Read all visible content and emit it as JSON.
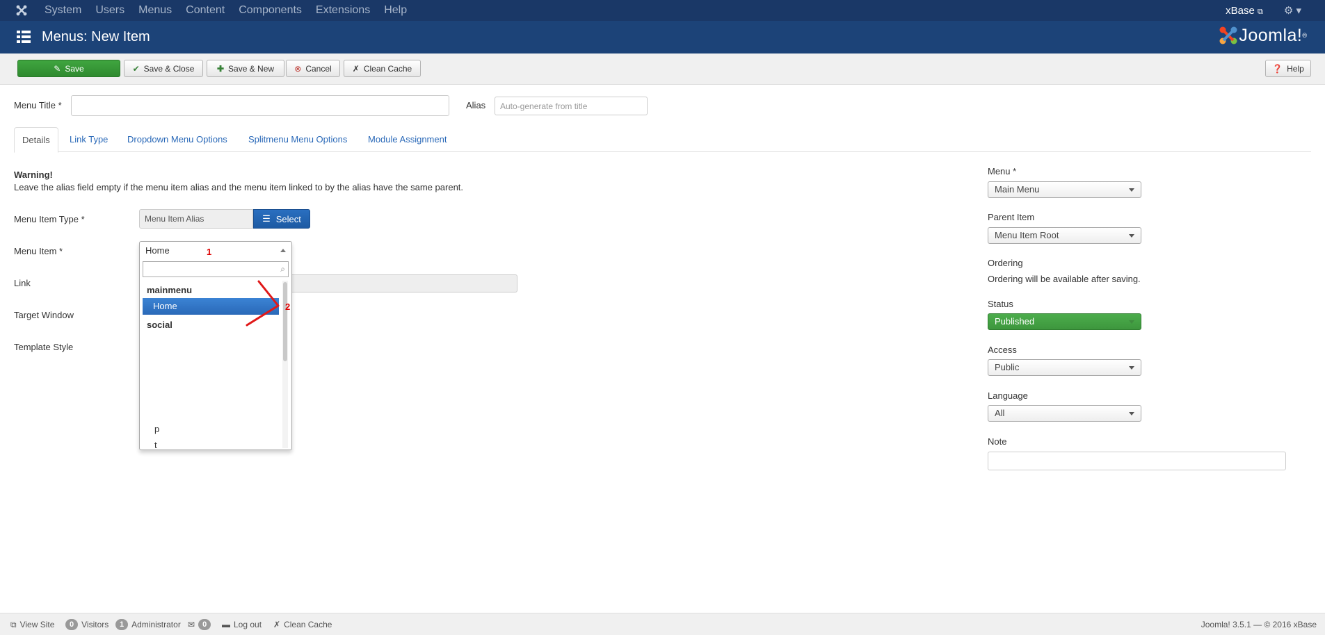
{
  "topnav": {
    "items": [
      "System",
      "Users",
      "Menus",
      "Content",
      "Components",
      "Extensions",
      "Help"
    ],
    "user": "xBase",
    "user_icon": "external-link-icon",
    "settings_icon": "gear-icon"
  },
  "header": {
    "title": "Menus: New Item",
    "brand": "Joomla!",
    "brand_mark": "®"
  },
  "toolbar": {
    "save": "Save",
    "save_close": "Save & Close",
    "save_new": "Save & New",
    "cancel": "Cancel",
    "clean_cache": "Clean Cache",
    "help": "Help"
  },
  "form": {
    "menu_title_label": "Menu Title *",
    "menu_title_value": "",
    "alias_label": "Alias",
    "alias_placeholder": "Auto-generate from title"
  },
  "tabs": [
    "Details",
    "Link Type",
    "Dropdown Menu Options",
    "Splitmenu Menu Options",
    "Module Assignment"
  ],
  "details": {
    "warning_title": "Warning!",
    "warning_text": "Leave the alias field empty if the menu item alias and the menu item linked to by the alias have the same parent.",
    "menu_item_type_label": "Menu Item Type *",
    "menu_item_type_value": "Menu Item Alias",
    "select_button": "Select",
    "menu_item_label": "Menu Item *",
    "menu_item_value": "Home",
    "link_label": "Link",
    "target_window_label": "Target Window",
    "template_style_label": "Template Style"
  },
  "dropdown": {
    "search_value": "",
    "groups": [
      {
        "label": "mainmenu",
        "options": [
          "Home"
        ]
      },
      {
        "label": "social",
        "options": []
      }
    ],
    "extra_options": [
      "p",
      "t"
    ]
  },
  "annotations": {
    "marker_1": "1",
    "marker_2": "2"
  },
  "sidebar": {
    "menu_label": "Menu *",
    "menu_value": "Main Menu",
    "parent_label": "Parent Item",
    "parent_value": "Menu Item Root",
    "ordering_label": "Ordering",
    "ordering_text": "Ordering will be available after saving.",
    "status_label": "Status",
    "status_value": "Published",
    "access_label": "Access",
    "access_value": "Public",
    "language_label": "Language",
    "language_value": "All",
    "note_label": "Note",
    "note_value": ""
  },
  "footer": {
    "view_site": "View Site",
    "visitors_count": "0",
    "visitors": "Visitors",
    "admin_count": "1",
    "administrator": "Administrator",
    "messages_count": "0",
    "log_out": "Log out",
    "clean_cache": "Clean Cache",
    "version": "Joomla! 3.5.1",
    "copyright": "— © 2016 xBase"
  },
  "colors": {
    "topbar": "#1a3867",
    "titlebar": "#1c4378",
    "primary": "#2a69b8",
    "success": "#3d963d",
    "annotation": "#dd0000"
  }
}
